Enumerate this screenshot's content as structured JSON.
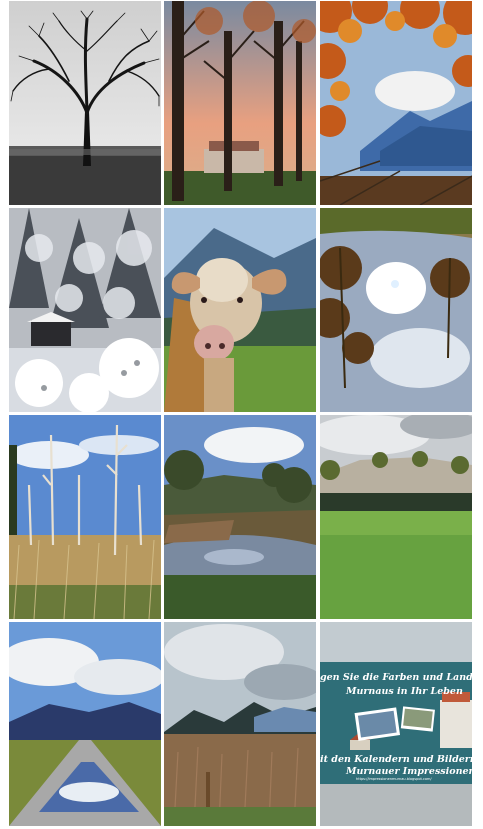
{
  "gallery": {
    "tiles": [
      {
        "subject": "bare-tree-black-and-white"
      },
      {
        "subject": "autumn-trees-sunset-village"
      },
      {
        "subject": "orange-leaves-mountain-view"
      },
      {
        "subject": "snowy-forest"
      },
      {
        "subject": "cow-portrait-meadow"
      },
      {
        "subject": "puddle-reflection-trees"
      },
      {
        "subject": "dead-trees-reeds-blue-sky"
      },
      {
        "subject": "creek-in-autumn-woods"
      },
      {
        "subject": "meadow-with-rock-cliff"
      },
      {
        "subject": "road-puddle-mountains"
      },
      {
        "subject": "autumn-field-mountains"
      },
      {
        "subject": "calendar-promo-banner"
      }
    ],
    "promo": {
      "line1": "gen Sie die Farben und Landschaf",
      "line2": "Murnaus in Ihr Leben",
      "line3": "it den Kalendern und Bildern vo",
      "line4": "Murnauer Impressionen",
      "url": "https://impressionenmurnau.blogspot.com/"
    }
  },
  "colors": {
    "background": "#ffffff",
    "promo_banner": "#2f6e78",
    "promo_text": "#ffffff"
  }
}
